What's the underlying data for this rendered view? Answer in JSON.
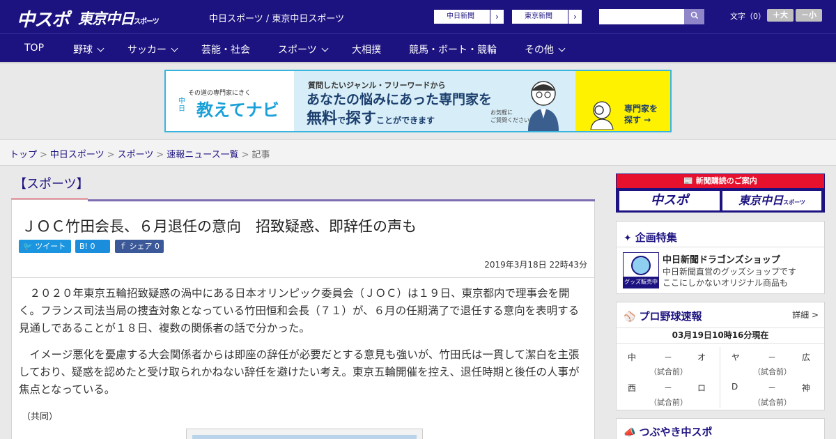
{
  "header": {
    "logo_chuspo": "中スポ",
    "logo_tokyo": "東京中日",
    "logo_tokyo_sub": "スポーツ",
    "site_link": "中日スポーツ / 東京中日スポーツ",
    "paper1": "中日新聞",
    "paper2": "東京新聞",
    "arrow": "›",
    "search_placeholder": "",
    "search_icon": "search-icon",
    "fontsize_label": "文字（0）",
    "font_bigger": "＋大",
    "font_smaller": "－小"
  },
  "nav": [
    {
      "label": "TOP"
    },
    {
      "label": "野球"
    },
    {
      "label": "サッカー"
    },
    {
      "label": "芸能・社会"
    },
    {
      "label": "スポーツ"
    },
    {
      "label": "大相撲"
    },
    {
      "label": "競馬・ボート・競輪"
    },
    {
      "label": "その他"
    }
  ],
  "banner": {
    "small": "その道の専門家にきく",
    "nichi": "中日",
    "brand": "教えてナビ",
    "line1": "質問したいジャンル・フリーワードから",
    "line2": "あなたの悩みにあった専門家を",
    "line3a": "無料",
    "line3b": "で",
    "line3c": "探す",
    "line3d": "ことができます",
    "note1": "お気軽に",
    "note2": "ご質問ください！",
    "cta1": "専門家を",
    "cta2": "探す →"
  },
  "breadcrumb": [
    {
      "label": "トップ"
    },
    {
      "label": "中日スポーツ"
    },
    {
      "label": "スポーツ"
    },
    {
      "label": "速報ニュース一覧"
    },
    {
      "label": "記事"
    }
  ],
  "article": {
    "category": "【スポーツ】",
    "headline": "ＪＯＣ竹田会長、６月退任の意向　招致疑惑、即辞任の声も",
    "share_tweet": "ツイート",
    "share_hatena": "B! 0",
    "share_facebook": "シェア 0",
    "date": "2019年3月18日 22時43分",
    "para1": "２０２０年東京五輪招致疑惑の渦中にある日本オリンピック委員会（ＪＯＣ）は１９日、東京都内で理事会を開く。フランス司法当局の捜査対象となっている竹田恒和会長（７１）が、６月の任期満了で退任する意向を表明する見通しであることが１８日、複数の関係者の話で分かった。",
    "para2": "イメージ悪化を憂慮する大会関係者からは即座の辞任が必要だとする意見も強いが、竹田氏は一貫して潔白を主張しており、疑惑を認めたと受け取られかねない辞任を避けたい考え。東京五輪開催を控え、退任時期と後任の人事が焦点となっている。",
    "credit": "（共同）"
  },
  "sidebar": {
    "subscription_title": "新聞購読のご案内",
    "sub_logo1": "中スポ",
    "sub_logo2": "東京中日",
    "sub_logo2_small": "スポーツ",
    "feature_title": "企画特集",
    "shop_tag": "グッズ販売中",
    "shop_name": "中日新聞ドラゴンズショップ",
    "shop_desc1": "中日新聞直営のグッズショップです",
    "shop_desc2": "ここにしかないオリジナル商品も",
    "baseball_title": "プロ野球速報",
    "baseball_detail": "詳細 >",
    "score_time": "03月19日10時16分現在",
    "games": [
      {
        "home": "中",
        "vs": "－",
        "away": "オ",
        "status": "（試合前）"
      },
      {
        "home": "ヤ",
        "vs": "－",
        "away": "広",
        "status": "（試合前）"
      },
      {
        "home": "西",
        "vs": "－",
        "away": "ロ",
        "status": "（試合前）"
      },
      {
        "home": "D",
        "vs": "－",
        "away": "神",
        "status": "（試合前）"
      }
    ],
    "tweet_title": "つぶやき中スポ"
  }
}
